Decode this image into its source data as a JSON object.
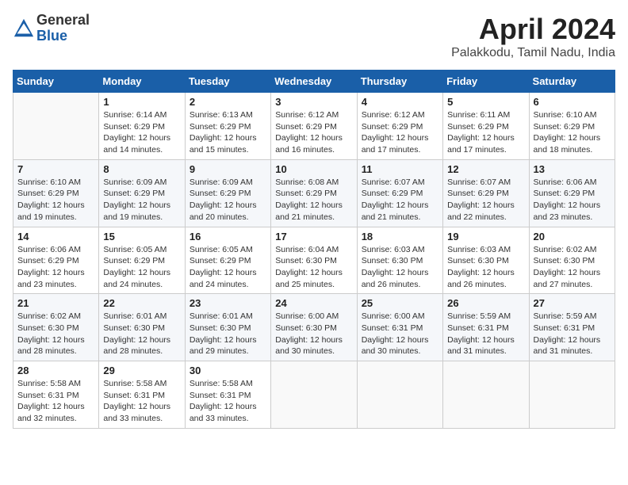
{
  "logo": {
    "general": "General",
    "blue": "Blue"
  },
  "title": "April 2024",
  "location": "Palakkodu, Tamil Nadu, India",
  "days_of_week": [
    "Sunday",
    "Monday",
    "Tuesday",
    "Wednesday",
    "Thursday",
    "Friday",
    "Saturday"
  ],
  "weeks": [
    [
      {
        "num": "",
        "info": ""
      },
      {
        "num": "1",
        "info": "Sunrise: 6:14 AM\nSunset: 6:29 PM\nDaylight: 12 hours\nand 14 minutes."
      },
      {
        "num": "2",
        "info": "Sunrise: 6:13 AM\nSunset: 6:29 PM\nDaylight: 12 hours\nand 15 minutes."
      },
      {
        "num": "3",
        "info": "Sunrise: 6:12 AM\nSunset: 6:29 PM\nDaylight: 12 hours\nand 16 minutes."
      },
      {
        "num": "4",
        "info": "Sunrise: 6:12 AM\nSunset: 6:29 PM\nDaylight: 12 hours\nand 17 minutes."
      },
      {
        "num": "5",
        "info": "Sunrise: 6:11 AM\nSunset: 6:29 PM\nDaylight: 12 hours\nand 17 minutes."
      },
      {
        "num": "6",
        "info": "Sunrise: 6:10 AM\nSunset: 6:29 PM\nDaylight: 12 hours\nand 18 minutes."
      }
    ],
    [
      {
        "num": "7",
        "info": "Sunrise: 6:10 AM\nSunset: 6:29 PM\nDaylight: 12 hours\nand 19 minutes."
      },
      {
        "num": "8",
        "info": "Sunrise: 6:09 AM\nSunset: 6:29 PM\nDaylight: 12 hours\nand 19 minutes."
      },
      {
        "num": "9",
        "info": "Sunrise: 6:09 AM\nSunset: 6:29 PM\nDaylight: 12 hours\nand 20 minutes."
      },
      {
        "num": "10",
        "info": "Sunrise: 6:08 AM\nSunset: 6:29 PM\nDaylight: 12 hours\nand 21 minutes."
      },
      {
        "num": "11",
        "info": "Sunrise: 6:07 AM\nSunset: 6:29 PM\nDaylight: 12 hours\nand 21 minutes."
      },
      {
        "num": "12",
        "info": "Sunrise: 6:07 AM\nSunset: 6:29 PM\nDaylight: 12 hours\nand 22 minutes."
      },
      {
        "num": "13",
        "info": "Sunrise: 6:06 AM\nSunset: 6:29 PM\nDaylight: 12 hours\nand 23 minutes."
      }
    ],
    [
      {
        "num": "14",
        "info": "Sunrise: 6:06 AM\nSunset: 6:29 PM\nDaylight: 12 hours\nand 23 minutes."
      },
      {
        "num": "15",
        "info": "Sunrise: 6:05 AM\nSunset: 6:29 PM\nDaylight: 12 hours\nand 24 minutes."
      },
      {
        "num": "16",
        "info": "Sunrise: 6:05 AM\nSunset: 6:29 PM\nDaylight: 12 hours\nand 24 minutes."
      },
      {
        "num": "17",
        "info": "Sunrise: 6:04 AM\nSunset: 6:30 PM\nDaylight: 12 hours\nand 25 minutes."
      },
      {
        "num": "18",
        "info": "Sunrise: 6:03 AM\nSunset: 6:30 PM\nDaylight: 12 hours\nand 26 minutes."
      },
      {
        "num": "19",
        "info": "Sunrise: 6:03 AM\nSunset: 6:30 PM\nDaylight: 12 hours\nand 26 minutes."
      },
      {
        "num": "20",
        "info": "Sunrise: 6:02 AM\nSunset: 6:30 PM\nDaylight: 12 hours\nand 27 minutes."
      }
    ],
    [
      {
        "num": "21",
        "info": "Sunrise: 6:02 AM\nSunset: 6:30 PM\nDaylight: 12 hours\nand 28 minutes."
      },
      {
        "num": "22",
        "info": "Sunrise: 6:01 AM\nSunset: 6:30 PM\nDaylight: 12 hours\nand 28 minutes."
      },
      {
        "num": "23",
        "info": "Sunrise: 6:01 AM\nSunset: 6:30 PM\nDaylight: 12 hours\nand 29 minutes."
      },
      {
        "num": "24",
        "info": "Sunrise: 6:00 AM\nSunset: 6:30 PM\nDaylight: 12 hours\nand 30 minutes."
      },
      {
        "num": "25",
        "info": "Sunrise: 6:00 AM\nSunset: 6:31 PM\nDaylight: 12 hours\nand 30 minutes."
      },
      {
        "num": "26",
        "info": "Sunrise: 5:59 AM\nSunset: 6:31 PM\nDaylight: 12 hours\nand 31 minutes."
      },
      {
        "num": "27",
        "info": "Sunrise: 5:59 AM\nSunset: 6:31 PM\nDaylight: 12 hours\nand 31 minutes."
      }
    ],
    [
      {
        "num": "28",
        "info": "Sunrise: 5:58 AM\nSunset: 6:31 PM\nDaylight: 12 hours\nand 32 minutes."
      },
      {
        "num": "29",
        "info": "Sunrise: 5:58 AM\nSunset: 6:31 PM\nDaylight: 12 hours\nand 33 minutes."
      },
      {
        "num": "30",
        "info": "Sunrise: 5:58 AM\nSunset: 6:31 PM\nDaylight: 12 hours\nand 33 minutes."
      },
      {
        "num": "",
        "info": ""
      },
      {
        "num": "",
        "info": ""
      },
      {
        "num": "",
        "info": ""
      },
      {
        "num": "",
        "info": ""
      }
    ]
  ]
}
